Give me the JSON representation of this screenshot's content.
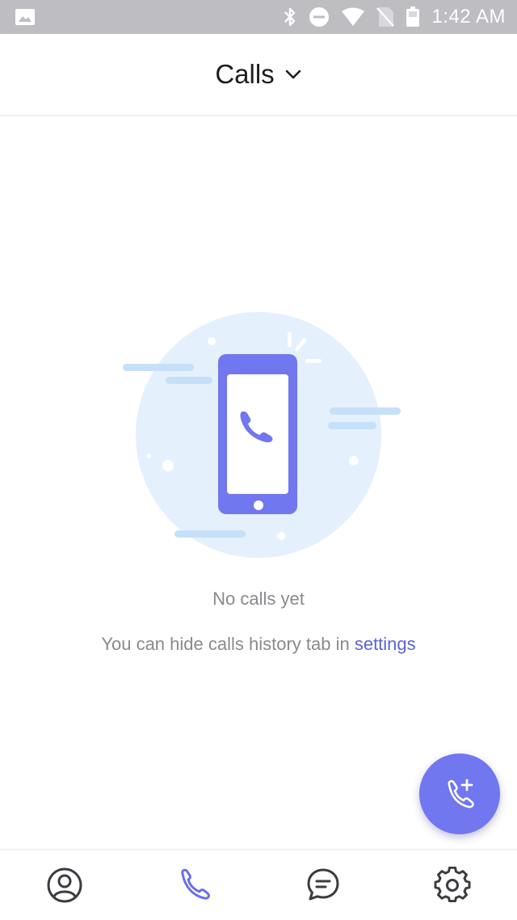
{
  "status_bar": {
    "time": "1:42 AM",
    "icons": [
      "image-icon",
      "bluetooth-icon",
      "do-not-disturb-icon",
      "wifi-icon",
      "no-sim-icon",
      "battery-icon"
    ]
  },
  "header": {
    "title": "Calls",
    "dropdown_icon": "chevron-down-icon"
  },
  "empty_state": {
    "title": "No calls yet",
    "hint_prefix": "You can hide calls history tab in ",
    "hint_link": "settings",
    "illustration_icon": "phone-illustration"
  },
  "fab": {
    "icon": "add-call-icon"
  },
  "bottom_nav": {
    "items": [
      {
        "icon": "contacts-icon",
        "active": false
      },
      {
        "icon": "calls-icon",
        "active": true
      },
      {
        "icon": "chats-icon",
        "active": false
      },
      {
        "icon": "settings-icon",
        "active": false
      }
    ]
  },
  "colors": {
    "accent": "#7177ee",
    "link": "#5b63d8",
    "status_bar": "#bdbdc2",
    "text_muted": "#8a8a8f",
    "illustration_bg": "#e4f0fc"
  }
}
